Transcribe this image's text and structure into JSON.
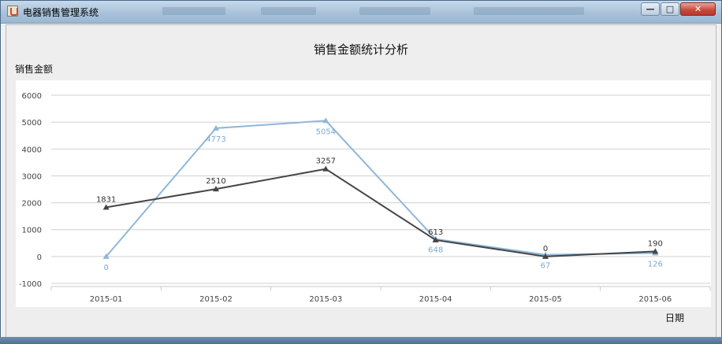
{
  "window": {
    "title": "电器销售管理系统",
    "buttons": {
      "minimize": "—",
      "maximize": "□",
      "close": "✕"
    }
  },
  "chart_data": {
    "type": "line",
    "title": "销售金额统计分析",
    "ylabel": "销售金额",
    "xlabel": "日期",
    "categories": [
      "2015-01",
      "2015-02",
      "2015-03",
      "2015-04",
      "2015-05",
      "2015-06"
    ],
    "ylim": [
      -1000,
      6000
    ],
    "yticks": [
      6000,
      5000,
      4000,
      3000,
      2000,
      1000,
      0,
      -1000
    ],
    "grid": true,
    "series": [
      {
        "color": "#8fb7d9",
        "marker": "triangle",
        "values": [
          0,
          4773,
          5054,
          648,
          67,
          126
        ]
      },
      {
        "color": "#454545",
        "marker": "triangle",
        "values": [
          1831,
          2510,
          3257,
          613,
          0,
          190
        ]
      }
    ]
  }
}
